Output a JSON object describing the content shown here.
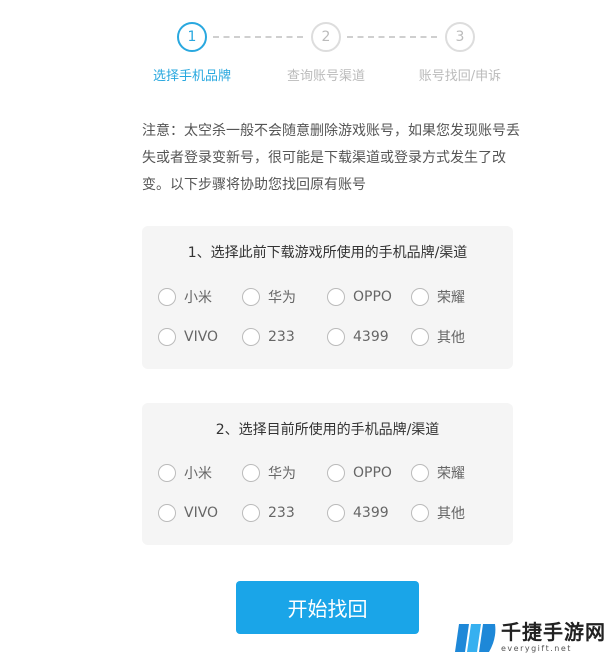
{
  "steps": [
    {
      "number": "1",
      "label": "选择手机品牌",
      "active": true
    },
    {
      "number": "2",
      "label": "查询账号渠道",
      "active": false
    },
    {
      "number": "3",
      "label": "账号找回/申诉",
      "active": false
    }
  ],
  "note": "注意：太空杀一般不会随意删除游戏账号，如果您发现账号丢失或者登录变新号，很可能是下载渠道或登录方式发生了改变。以下步骤将协助您找回原有账号",
  "question1": {
    "title": "1、选择此前下载游戏所使用的手机品牌/渠道",
    "options": [
      "小米",
      "华为",
      "OPPO",
      "荣耀",
      "VIVO",
      "233",
      "4399",
      "其他"
    ]
  },
  "question2": {
    "title": "2、选择目前所使用的手机品牌/渠道",
    "options": [
      "小米",
      "华为",
      "OPPO",
      "荣耀",
      "VIVO",
      "233",
      "4399",
      "其他"
    ]
  },
  "submit_label": "开始找回",
  "watermark": {
    "title": "千捷手游网",
    "subtitle": "everygift.net"
  },
  "colors": {
    "accent": "#29a8df",
    "button": "#1aa5e8",
    "card_bg": "#f5f5f5"
  }
}
